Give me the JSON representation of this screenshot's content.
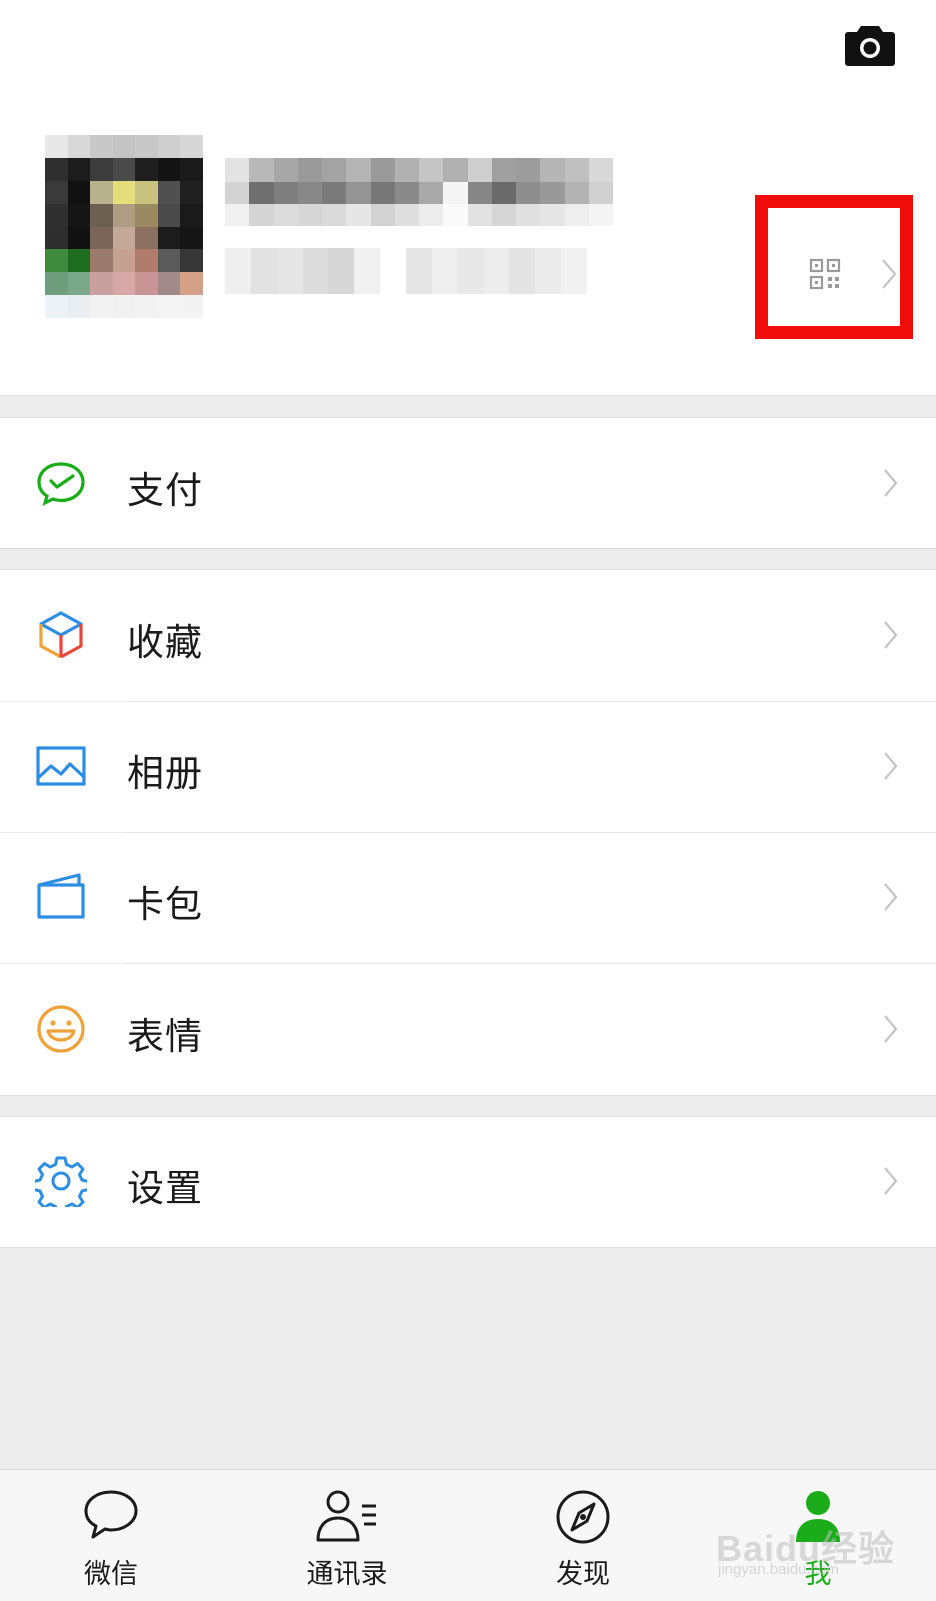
{
  "profile": {
    "camera_icon": "camera-icon",
    "qr_icon": "qr-code-icon",
    "highlight_color": "#f20d0d"
  },
  "menu": [
    {
      "label": "支付",
      "icon": "wechat-pay-icon",
      "color": "#1aad19"
    },
    {
      "label": "收藏",
      "icon": "favorites-cube-icon",
      "color": "#2b8de3"
    },
    {
      "label": "相册",
      "icon": "album-image-icon",
      "color": "#2b8de3"
    },
    {
      "label": "卡包",
      "icon": "card-wallet-icon",
      "color": "#2b8de3"
    },
    {
      "label": "表情",
      "icon": "sticker-smile-icon",
      "color": "#f0a23a"
    },
    {
      "label": "设置",
      "icon": "settings-gear-icon",
      "color": "#2b8de3"
    }
  ],
  "tabbar": {
    "tabs": [
      {
        "label": "微信",
        "icon": "chat-bubble-icon",
        "active": false
      },
      {
        "label": "通讯录",
        "icon": "contacts-icon",
        "active": false
      },
      {
        "label": "发现",
        "icon": "compass-icon",
        "active": false
      },
      {
        "label": "我",
        "icon": "me-person-icon",
        "active": true
      }
    ],
    "active_color": "#1aad19"
  },
  "watermark": {
    "text": "Baidu经验",
    "sub": "jingyan.baidu.com"
  }
}
